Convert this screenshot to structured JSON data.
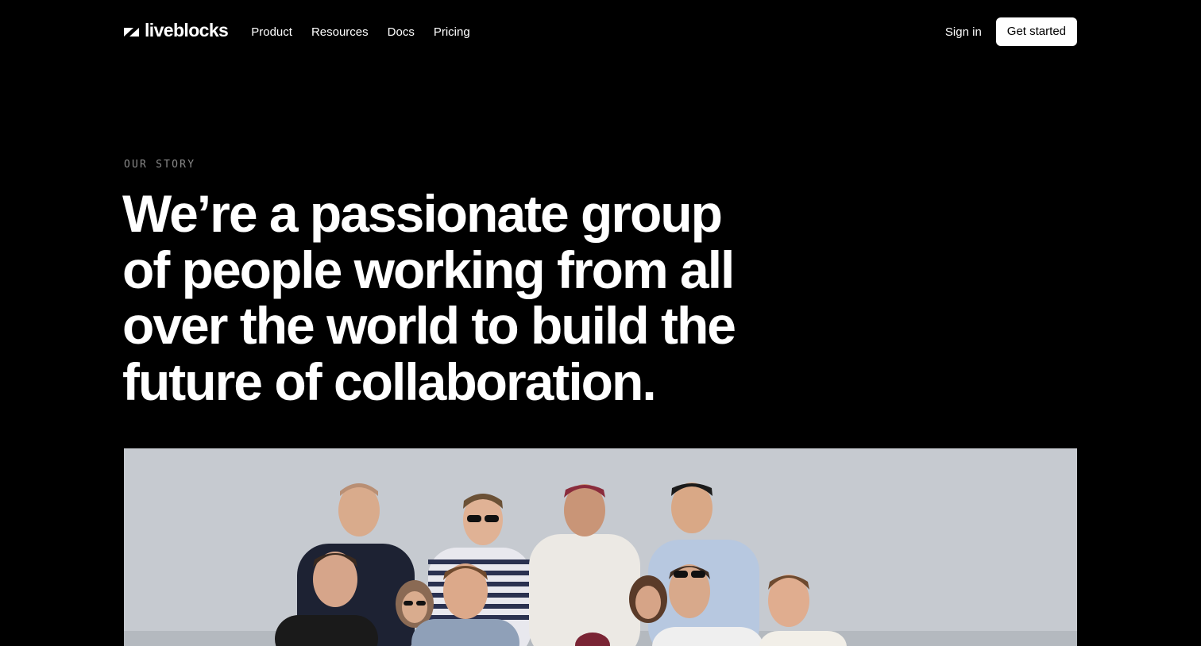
{
  "nav": {
    "logo_text": "liveblocks",
    "links": [
      "Product",
      "Resources",
      "Docs",
      "Pricing"
    ],
    "signin_label": "Sign in",
    "cta_label": "Get started"
  },
  "hero": {
    "eyebrow": "OUR STORY",
    "headline": "We’re a passionate group of people working from all over the world to build the future of collaboration."
  },
  "colors": {
    "background": "#000000",
    "text": "#ffffff",
    "eyebrow": "#8a8a8a",
    "cta_bg": "#ffffff",
    "cta_text": "#000000"
  },
  "icons": {
    "logo": "liveblocks-logo-icon"
  }
}
